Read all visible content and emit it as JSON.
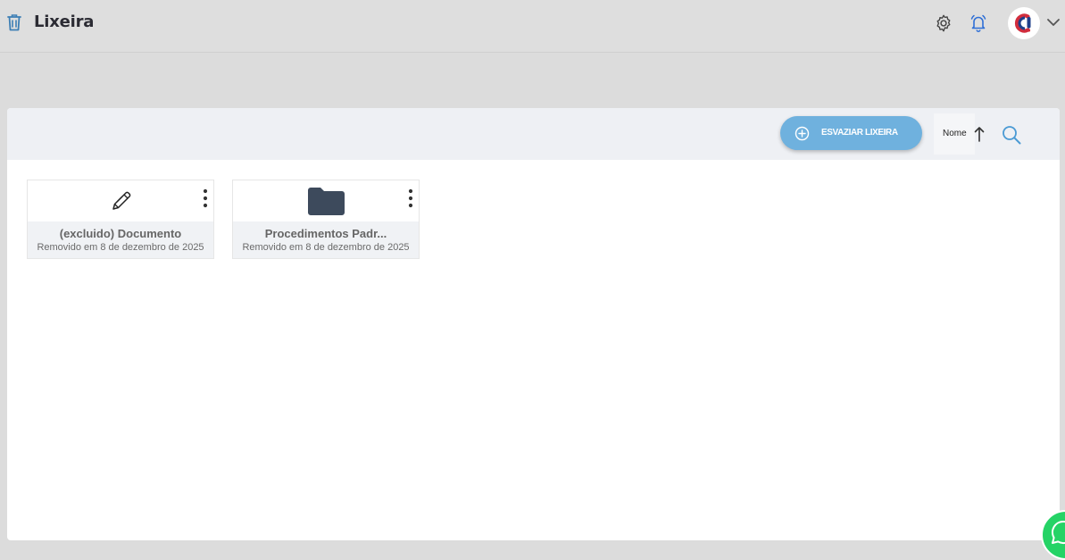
{
  "header": {
    "title": "Lixeira",
    "icons": [
      "trash-icon",
      "gear-icon",
      "bell-icon",
      "avatar",
      "chevron-down-icon"
    ]
  },
  "toolbar": {
    "empty_trash_label": "ESVAZIAR LIXEIRA",
    "sort_label": "Nome",
    "sort_direction": "ascending"
  },
  "items": [
    {
      "name": "(excluido) Documento",
      "removed": "Removido em 8 de dezembro de 2025",
      "icon": "pencil-icon"
    },
    {
      "name": "Procedimentos Padr...",
      "removed": "Removido em 8 de dezembro de 2025",
      "icon": "folder-icon"
    }
  ],
  "colors": {
    "accent": "#6fb1de",
    "folder": "#3d4a5c",
    "title": "#2b2b33",
    "notification": "#2f6fd6",
    "whatsapp": "#25d366"
  }
}
